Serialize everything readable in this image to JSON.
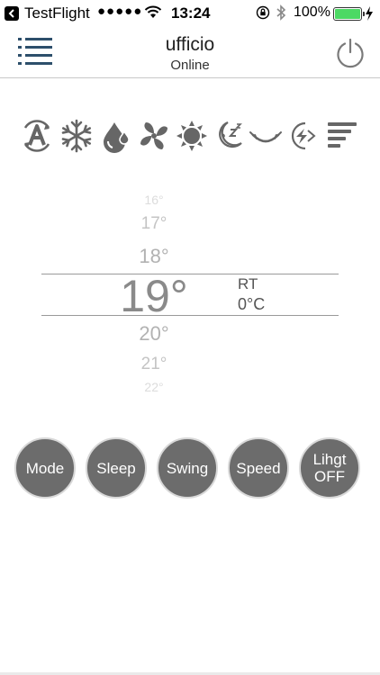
{
  "status_bar": {
    "carrier": "TestFlight",
    "signal": "●●●●●",
    "time": "13:24",
    "battery_percent": "100%",
    "battery_color": "#4cd964",
    "icons": [
      "back-icon",
      "wifi-icon",
      "orientation-lock-icon",
      "bluetooth-icon",
      "battery-icon",
      "charging-bolt-icon"
    ]
  },
  "header": {
    "title": "ufficio",
    "status": "Online",
    "menu_icon": "hamburger-menu-icon",
    "power_icon": "power-icon"
  },
  "modes": [
    {
      "name": "auto-mode-icon"
    },
    {
      "name": "cool-mode-icon"
    },
    {
      "name": "dry-mode-icon"
    },
    {
      "name": "fan-mode-icon"
    },
    {
      "name": "heat-mode-icon"
    },
    {
      "name": "sleep-mode-icon"
    },
    {
      "name": "eco-mode-icon"
    },
    {
      "name": "turbo-mode-icon"
    },
    {
      "name": "fan-speed-icon"
    }
  ],
  "picker": {
    "values": [
      "16°",
      "17°",
      "18°",
      "19°",
      "20°",
      "21°",
      "22°"
    ],
    "selected": "19°",
    "room_temp_label": "RT",
    "room_temp_value": "0°C"
  },
  "buttons": {
    "mode": "Mode",
    "sleep": "Sleep",
    "swing": "Swing",
    "speed": "Speed",
    "light_line1": "Lihgt",
    "light_line2": "OFF",
    "button_color": "#6c6c6c"
  }
}
